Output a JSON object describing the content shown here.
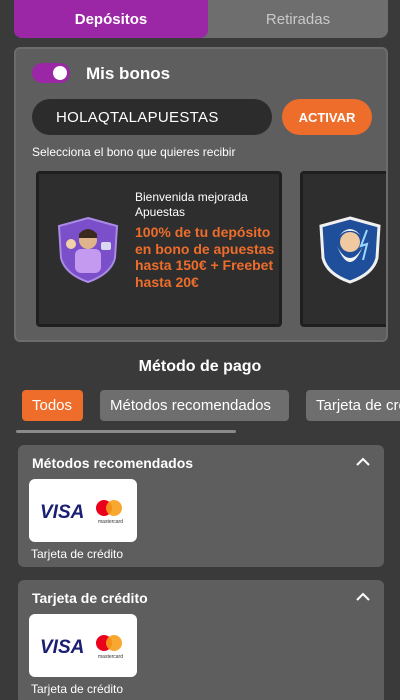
{
  "tabs": [
    {
      "label": "Depósitos",
      "active": true
    },
    {
      "label": "Retiradas",
      "active": false
    }
  ],
  "bonus": {
    "title": "Mis bonos",
    "toggle_on": true,
    "code_value": "HOLAQTALAPUESTAS",
    "activate_label": "ACTIVAR",
    "select_label": "Selecciona el bono que quieres recibir",
    "cards": [
      {
        "subtitle": "Bienvenida mejorada Apuestas",
        "offer": "100% de tu depósito en bono de apuestas hasta 150€ + Freebet hasta 20€"
      }
    ]
  },
  "payment": {
    "title": "Método de pago",
    "filters": [
      "Todos",
      "Métodos recomendados",
      "Tarjeta de crédito"
    ],
    "active_filter": "Todos",
    "sections": [
      {
        "header": "Métodos recomendados",
        "method_label": "Tarjeta de crédito",
        "brand": "VISA",
        "mc_text": "mastercard"
      },
      {
        "header": "Tarjeta de crédito",
        "method_label": "Tarjeta de crédito",
        "brand": "VISA",
        "mc_text": "mastercard"
      }
    ]
  },
  "colors": {
    "accent_purple": "#9c27a6",
    "accent_orange": "#ee6d2b",
    "panel": "#5e5e5e",
    "background": "#3a3a3a"
  }
}
